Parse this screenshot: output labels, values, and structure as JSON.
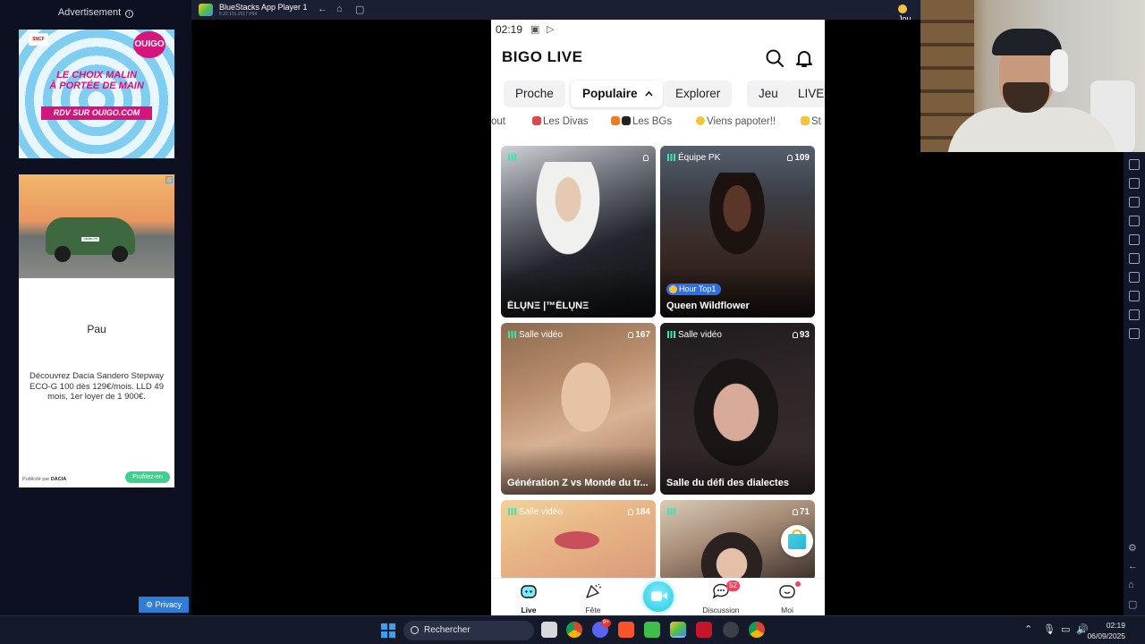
{
  "ads": {
    "label": "Advertisement",
    "info_glyph": "i",
    "ad1": {
      "badge": "SNCF",
      "brand": "OUIGO",
      "slogan_line1": "LE CHOIX MALIN",
      "slogan_line2": "À PORTÉE DE MAIN",
      "cta": "RDV SUR OUIGO.COM",
      "color": "#d6157b"
    },
    "ad2": {
      "plate": "GB-883-TB",
      "city": "Pau",
      "description": "Découvrez Dacia Sandero Stepway ECO-G 100 dès 129€/mois. LLD 49 mois, 1er loyer de 1 900€.",
      "sponsor_prefix": "Publicité par",
      "sponsor": "DACIA",
      "cta": "Profitez-en"
    },
    "privacy": "Privacy"
  },
  "bluestacks": {
    "title": "BlueStacks App Player 1",
    "version": "5.22.101.2017  P64",
    "account": "Jou"
  },
  "phone": {
    "status_time": "02:19",
    "brand": "BIGO LIVE",
    "tabs": [
      {
        "label": "Proche"
      },
      {
        "label": "Populaire",
        "active": true
      },
      {
        "label": "Explorer"
      },
      {
        "label": "Jeu"
      },
      {
        "label": "LIVE"
      }
    ],
    "chips": [
      {
        "label": "out"
      },
      {
        "label": "Les Divas",
        "icon": "dancer"
      },
      {
        "label": "Les BGs",
        "icon": "fire-sunglasses"
      },
      {
        "label": "Viens papoter!!",
        "icon": "smile"
      },
      {
        "label": "St",
        "icon": "sparkles"
      }
    ],
    "cards": [
      {
        "tag": "",
        "viewers": "",
        "title": "ĒLŲNΞ |™ĒLŲNΞ",
        "badge": ""
      },
      {
        "tag": "Équipe PK",
        "viewers": "109",
        "title": "Queen Wildflower",
        "badge": "Hour Top1"
      },
      {
        "tag": "Salle vidéo",
        "viewers": "167",
        "title": "Génération Z vs Monde du tr...",
        "badge": ""
      },
      {
        "tag": "Salle vidéo",
        "viewers": "93",
        "title": "Salle du défi des dialectes",
        "badge": ""
      },
      {
        "tag": "Salle vidéo",
        "viewers": "184",
        "title": "",
        "badge": ""
      },
      {
        "tag": "",
        "viewers": "71",
        "title": "",
        "badge": ""
      }
    ],
    "nav": [
      {
        "label": "Live",
        "active": true
      },
      {
        "label": "Fête"
      },
      {
        "label": ""
      },
      {
        "label": "Discussion",
        "count": "52"
      },
      {
        "label": "Moi",
        "dot": true
      }
    ],
    "accent": "#27c7de"
  },
  "taskbar": {
    "search_placeholder": "Rechercher",
    "time": "02:19",
    "date": "06/09/2025",
    "discord_badge": "9+"
  }
}
